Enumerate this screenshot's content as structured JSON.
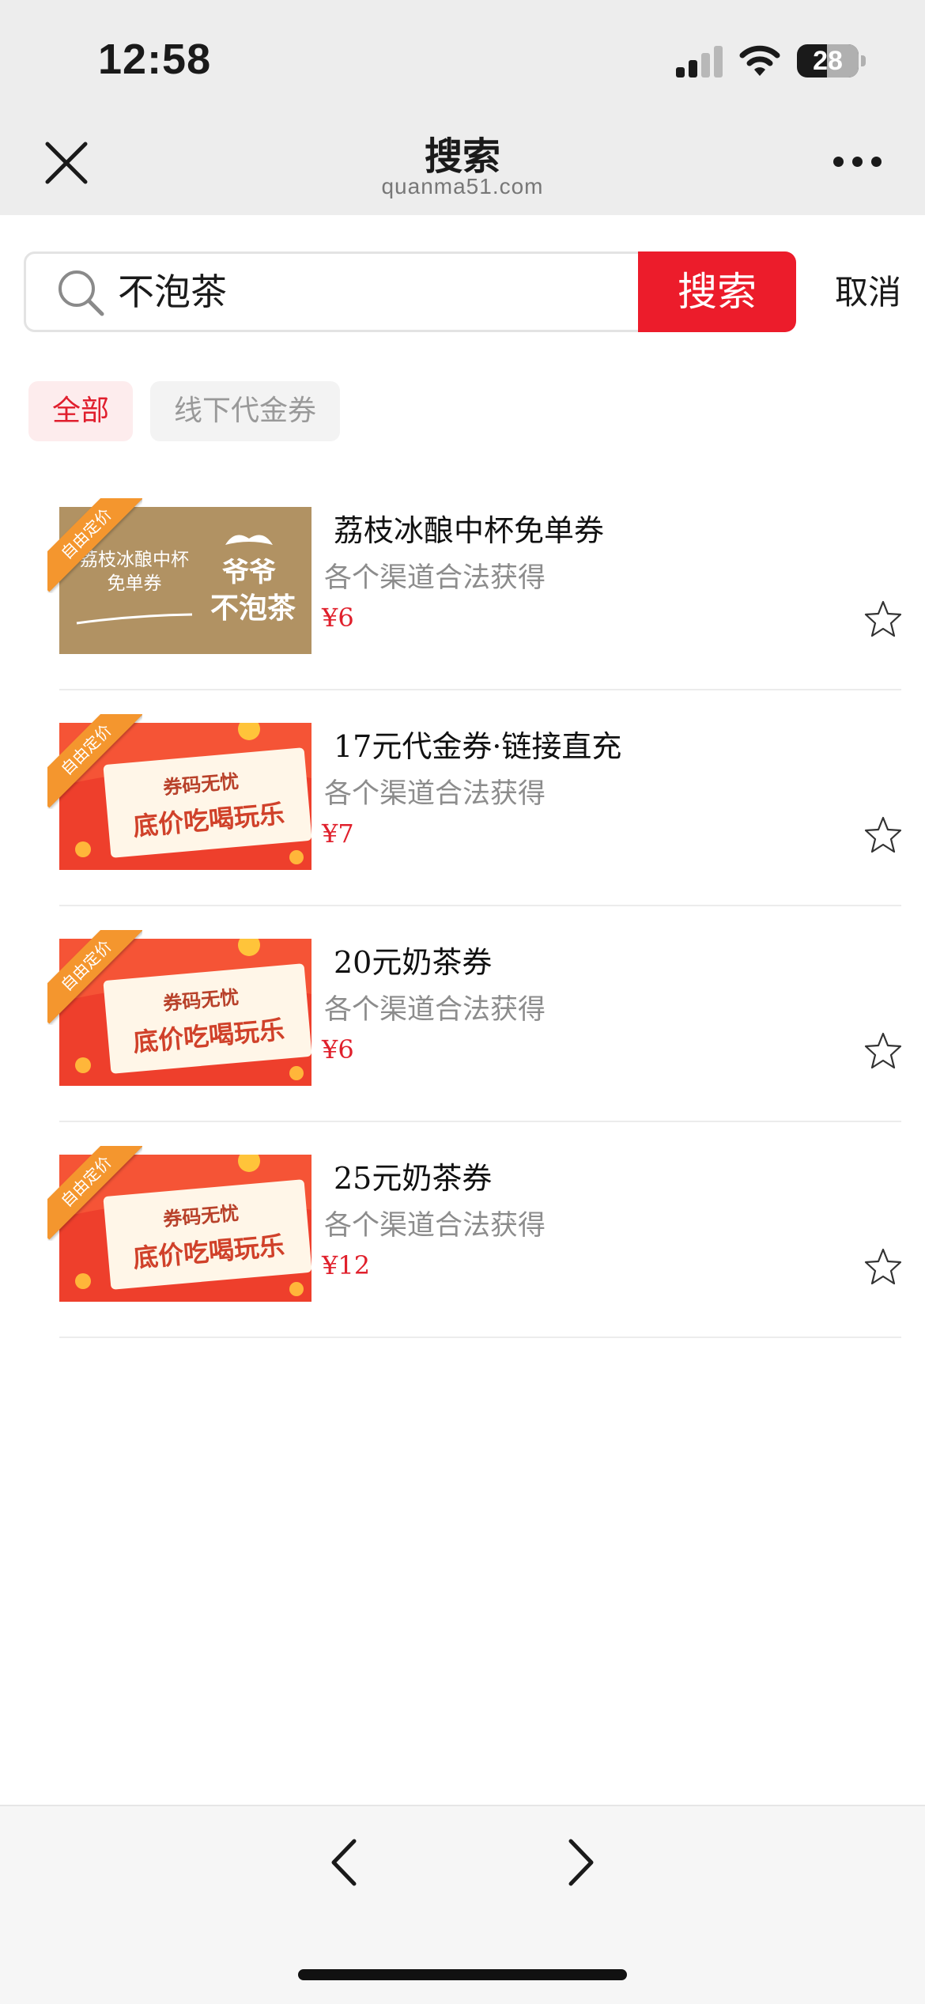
{
  "status_bar": {
    "time": "12:58",
    "battery": "28"
  },
  "nav": {
    "title": "搜索",
    "url": "quanma51.com"
  },
  "search": {
    "query": "不泡茶",
    "button": "搜索",
    "cancel": "取消"
  },
  "filters": [
    {
      "label": "全部",
      "active": true
    },
    {
      "label": "线下代金券",
      "active": false
    }
  ],
  "thumb_ribbon": "自由定价",
  "thumb_brand": {
    "caption_line1": "荔枝冰酿中杯",
    "caption_line2": "免单券",
    "logo_line1": "爷爷",
    "logo_line2": "不泡茶"
  },
  "thumb_promo": {
    "line1": "券码无忧",
    "line2": "底价吃喝玩乐"
  },
  "items": [
    {
      "title": "荔枝冰酿中杯免单券",
      "subtitle": "各个渠道合法获得",
      "price": "¥6",
      "thumb": "brand"
    },
    {
      "title": "17元代金券·链接直充",
      "subtitle": "各个渠道合法获得",
      "price": "¥7",
      "thumb": "promo"
    },
    {
      "title": "20元奶茶券",
      "subtitle": "各个渠道合法获得",
      "price": "¥6",
      "thumb": "promo"
    },
    {
      "title": "25元奶茶券",
      "subtitle": "各个渠道合法获得",
      "price": "¥12",
      "thumb": "promo"
    }
  ],
  "colors": {
    "accent": "#ec1c2b",
    "price": "#e0202c",
    "ribbon": "#f4962e",
    "brand_thumb_bg": "#b19263"
  }
}
